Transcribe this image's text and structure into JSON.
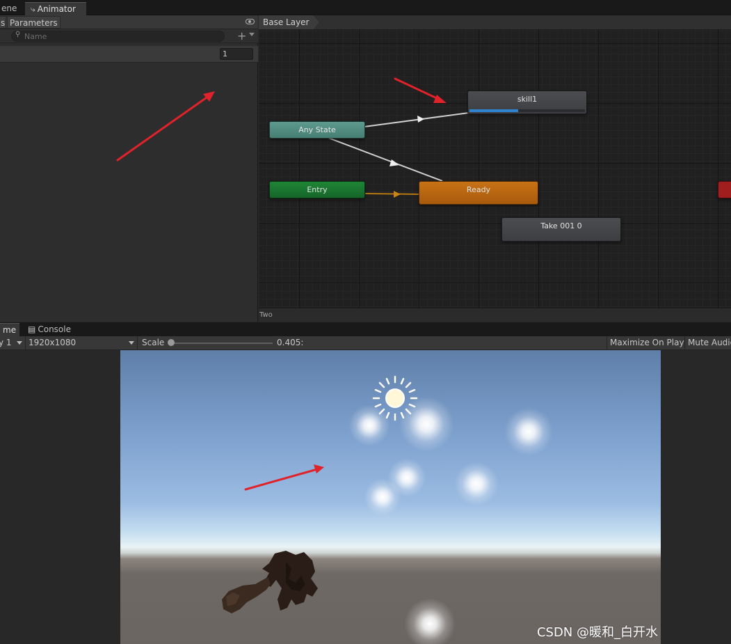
{
  "top_tabs": {
    "scene_label": "ene",
    "animator_label": "Animator"
  },
  "left_panel": {
    "layers_tab": "s",
    "parameters_tab": "Parameters",
    "search_placeholder": "Name",
    "add_label": "+",
    "param_value": "1"
  },
  "graph": {
    "breadcrumb": "Base Layer",
    "footer": "Two",
    "states": {
      "skill1": {
        "label": "skill1",
        "progress": 0.42
      },
      "any_state": "Any State",
      "entry": "Entry",
      "ready": "Ready",
      "take": "Take 001 0"
    }
  },
  "game": {
    "game_tab": "me",
    "console_tab": "Console",
    "display": "y 1",
    "resolution": "1920x1080",
    "scale_label": "Scale",
    "scale_value": "0.405:",
    "maximize_label": "Maximize On Play",
    "mute_label": "Mute Audic",
    "watermark": "CSDN @暖和_白开水"
  },
  "colors": {
    "any_state": "#5d9a8e",
    "entry": "#1f8535",
    "ready": "#c77216",
    "skill_progress": "#2f84d1",
    "annotation_arrow": "#e0222a"
  }
}
